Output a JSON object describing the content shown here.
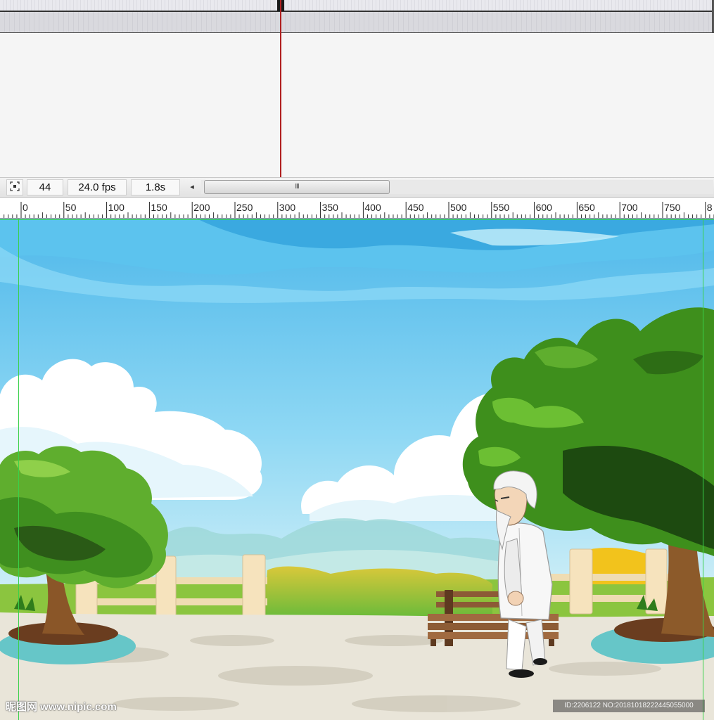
{
  "timeline": {
    "current_frame": "44",
    "frame_rate": "24.0 fps",
    "elapsed_time": "1.8s",
    "scroll_left_glyph": "◂",
    "scroll_thumb_grip": "III"
  },
  "ruler": {
    "labels": [
      "0",
      "50",
      "100",
      "150",
      "200",
      "250",
      "300",
      "350",
      "400",
      "450",
      "500",
      "550",
      "600",
      "650",
      "700",
      "750",
      "8"
    ]
  },
  "stage": {
    "scene": "park scene with trees, bench and old man in white",
    "sky_color": "#7ccfee",
    "ground_color": "#e8e4d8",
    "guide_color": "#3ad14a"
  },
  "watermark": {
    "left": "昵图网 www.nipic.com",
    "right": "ID:2206122 NO:20181018222445055000"
  },
  "icons": {
    "center_frame": "center-frame-icon"
  }
}
